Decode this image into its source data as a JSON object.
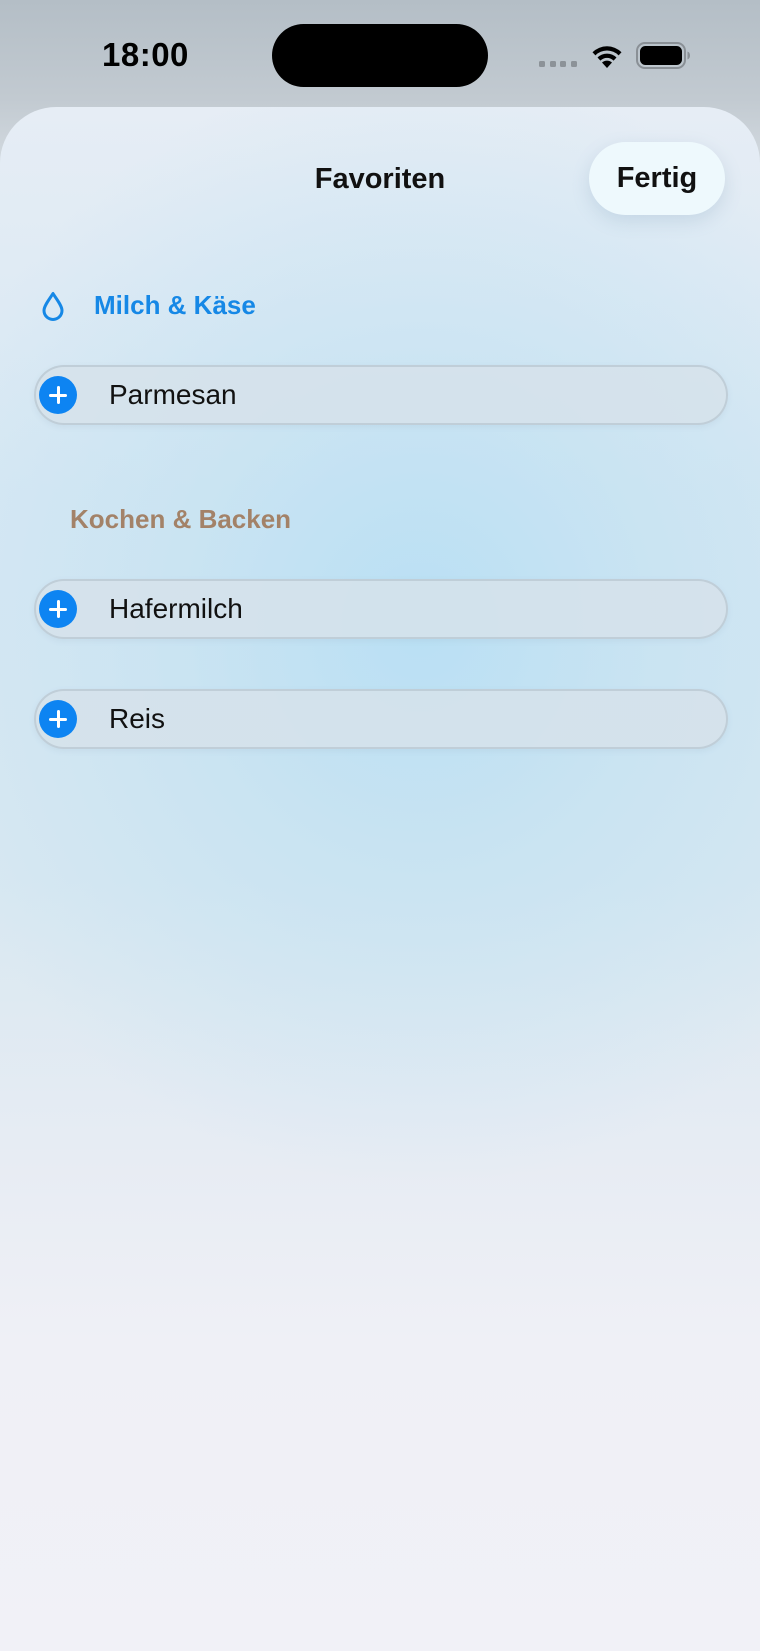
{
  "status_bar": {
    "time": "18:00",
    "icons": [
      "cellular-dots-icon",
      "wifi-icon",
      "battery-icon"
    ]
  },
  "nav": {
    "title": "Favoriten",
    "done_label": "Fertig"
  },
  "sections": [
    {
      "title": "Milch & Käse",
      "icon": "water-drop-icon",
      "color": "#1688e6",
      "items": [
        {
          "label": "Parmesan",
          "action_icon": "plus-circle-icon"
        }
      ]
    },
    {
      "title": "Kochen & Backen",
      "color": "#a38268",
      "items": [
        {
          "label": "Hafermilch",
          "action_icon": "plus-circle-icon"
        },
        {
          "label": "Reis",
          "action_icon": "plus-circle-icon"
        }
      ]
    }
  ],
  "colors": {
    "accent": "#0d84f2",
    "text": "#111111"
  }
}
